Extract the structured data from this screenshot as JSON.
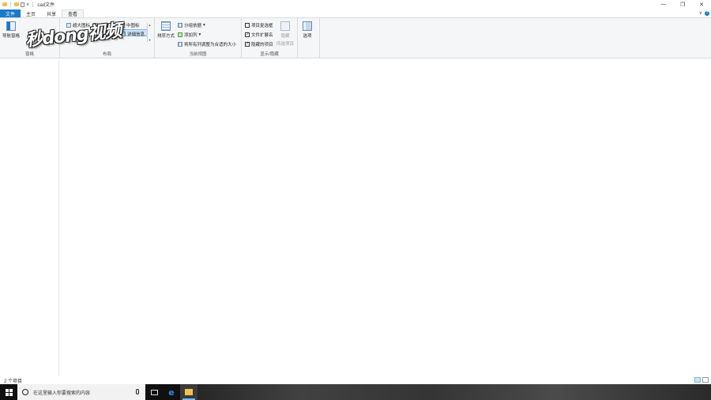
{
  "window": {
    "title": "cad文件",
    "controls": {
      "minimize": "—",
      "maximize": "❐",
      "close": "✕"
    }
  },
  "tabs": [
    {
      "label": "文件"
    },
    {
      "label": "主页"
    },
    {
      "label": "共享"
    },
    {
      "label": "查看"
    }
  ],
  "ribbon": {
    "pane": {
      "nav_pane": "导航窗格",
      "label": "窗格"
    },
    "layout": {
      "extra_large": "超大图标",
      "large": "大图标",
      "medium": "中图标",
      "details": "详细信息",
      "label": "布局"
    },
    "current_view": {
      "sort_by": "排序方式",
      "group_by": "分组依据",
      "add_column": "添加列",
      "fit_columns": "将所有列调整为合适的大小",
      "label": "当前视图"
    },
    "show_hide": {
      "item_checkboxes": "项目复选框",
      "file_extensions": "文件扩展名",
      "hidden_items": "隐藏的项目",
      "hide_selected": "隐藏",
      "hide_selected_2": "所选项目",
      "label": "显示/隐藏"
    },
    "options": {
      "label": "选项"
    }
  },
  "watermark": "秒dong视频",
  "status": {
    "items": "2 个项目"
  },
  "taskbar": {
    "search_placeholder": "在这里输入你要搜索的内容"
  },
  "colors": {
    "file_tab": "#1979ca",
    "ribbon_bg": "#f5f6f7",
    "taskbar": "#101010",
    "selected": "#cce4f7"
  }
}
